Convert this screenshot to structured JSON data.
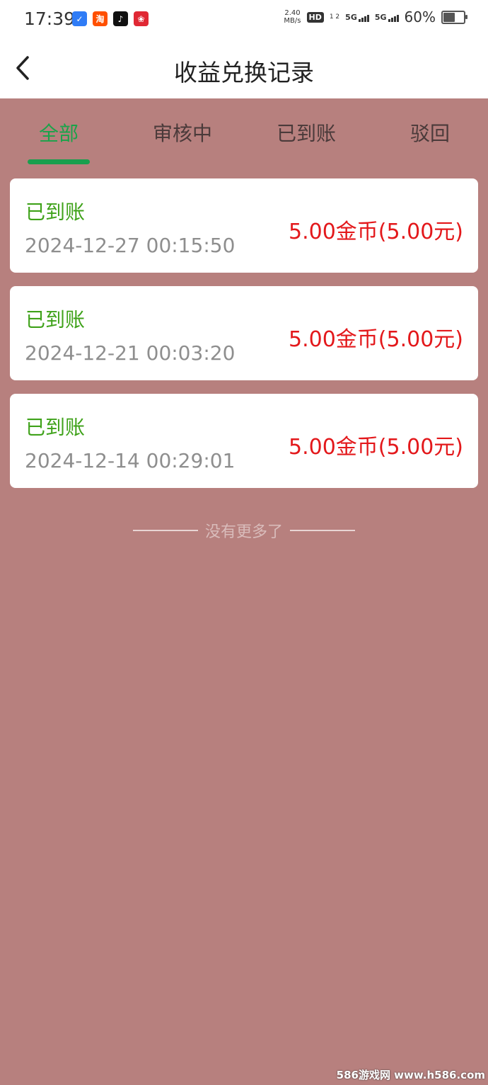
{
  "status_bar": {
    "time": "17:39",
    "app_icons": [
      {
        "name": "shield-app-icon",
        "glyph": "✓",
        "color": "#2f7cf6"
      },
      {
        "name": "taobao-app-icon",
        "glyph": "淘",
        "color": "#ff5000"
      },
      {
        "name": "tiktok-app-icon",
        "glyph": "♪",
        "color": "#111111"
      },
      {
        "name": "red-app-icon",
        "glyph": "❀",
        "color": "#e02834"
      }
    ],
    "net_speed_value": "2.40",
    "net_speed_unit": "MB/s",
    "hd_label": "HD",
    "hd_sub": "1 2",
    "signal1_label": "5G",
    "signal2_label": "5G",
    "battery_percent": "60%",
    "battery_level": 0.6
  },
  "header": {
    "title": "收益兑换记录",
    "back_icon": "chevron-left-icon"
  },
  "tabs": [
    {
      "label": "全部",
      "active": true
    },
    {
      "label": "审核中",
      "active": false
    },
    {
      "label": "已到账",
      "active": false
    },
    {
      "label": "驳回",
      "active": false
    }
  ],
  "records": [
    {
      "status": "已到账",
      "time": "2024-12-27 00:15:50",
      "amount": "5.00金币(5.00元)"
    },
    {
      "status": "已到账",
      "time": "2024-12-21 00:03:20",
      "amount": "5.00金币(5.00元)"
    },
    {
      "status": "已到账",
      "time": "2024-12-14 00:29:01",
      "amount": "5.00金币(5.00元)"
    }
  ],
  "end_note": "没有更多了",
  "watermark": "586游戏网 www.h586.com",
  "colors": {
    "background": "#b7807e",
    "active_tab": "#1aa34a",
    "status_text": "#3fa21a",
    "amount_text": "#e3181b"
  }
}
